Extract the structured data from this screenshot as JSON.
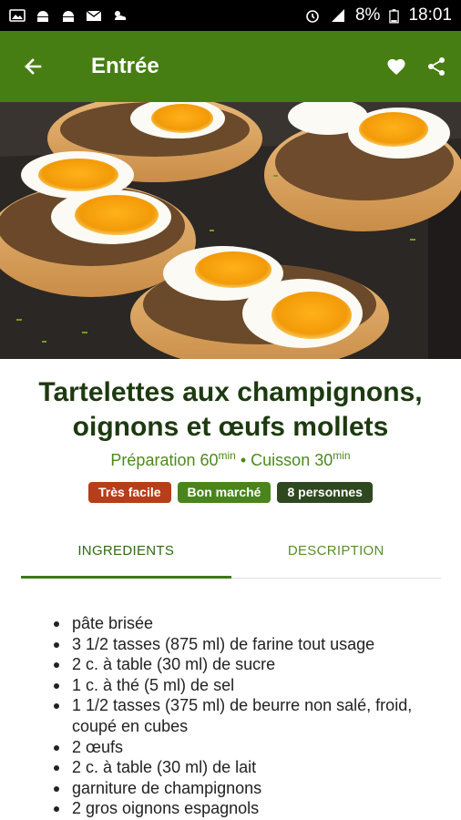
{
  "status_bar": {
    "icons_left": [
      "gallery-icon",
      "android-icon",
      "android-icon",
      "mail-icon",
      "weather-icon"
    ],
    "battery": "8%",
    "time": "18:01"
  },
  "app_bar": {
    "title": "Entrée",
    "color": "#477e13"
  },
  "recipe": {
    "title": "Tartelettes aux champignons, oignons et œufs mollets",
    "prep_label": "Préparation 60",
    "prep_unit": "min",
    "separator": " • ",
    "cook_label": "Cuisson 30",
    "cook_unit": "min",
    "badges": {
      "difficulty": "Très facile",
      "cost": "Bon marché",
      "servings": "8 personnes"
    }
  },
  "tabs": {
    "ingredients": "INGREDIENTS",
    "description": "DESCRIPTION",
    "active": "ingredients"
  },
  "ingredients": [
    "pâte brisée",
    "3 1/2 tasses (875 ml) de farine tout usage",
    "2 c. à table (30 ml) de sucre",
    "1 c. à thé (5 ml) de sel",
    "1 1/2 tasses (375 ml) de beurre non salé, froid, coupé en cubes",
    "2 œufs",
    "2 c. à table (30 ml) de lait",
    "garniture de champignons",
    "2 gros oignons espagnols"
  ]
}
